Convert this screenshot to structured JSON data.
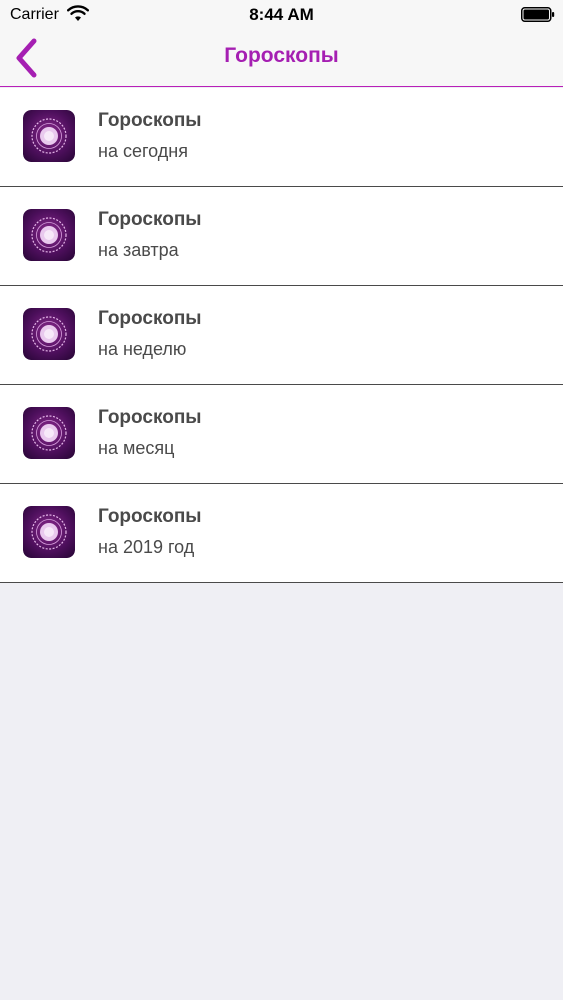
{
  "status_bar": {
    "carrier": "Carrier",
    "time": "8:44 AM"
  },
  "nav": {
    "title": "Гороскопы",
    "back_icon": "chevron-left-icon",
    "accent_color": "#a51fb2"
  },
  "list": {
    "items": [
      {
        "title": "Гороскопы",
        "subtitle": "на сегодня",
        "icon": "horoscope-app-icon"
      },
      {
        "title": "Гороскопы",
        "subtitle": "на завтра",
        "icon": "horoscope-app-icon"
      },
      {
        "title": "Гороскопы",
        "subtitle": "на неделю",
        "icon": "horoscope-app-icon"
      },
      {
        "title": "Гороскопы",
        "subtitle": "на месяц",
        "icon": "horoscope-app-icon"
      },
      {
        "title": "Гороскопы",
        "subtitle": "на 2019 год",
        "icon": "horoscope-app-icon"
      }
    ]
  }
}
